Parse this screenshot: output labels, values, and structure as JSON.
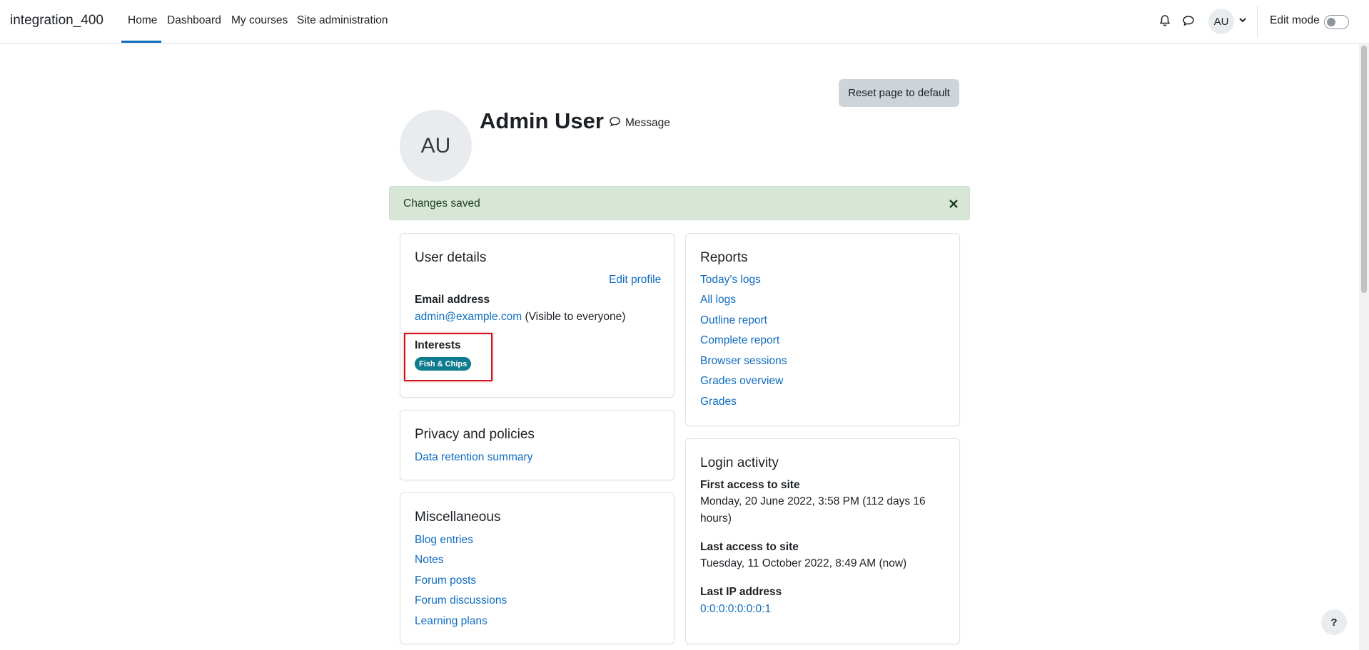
{
  "navbar": {
    "brand": "integration_400",
    "links": [
      "Home",
      "Dashboard",
      "My courses",
      "Site administration"
    ],
    "avatar_initials": "AU",
    "edit_mode_label": "Edit mode"
  },
  "header": {
    "reset_label": "Reset page to default",
    "avatar_initials": "AU",
    "user_name": "Admin User",
    "message_label": "Message"
  },
  "alert": {
    "text": "Changes saved"
  },
  "user_details": {
    "title": "User details",
    "edit_profile": "Edit profile",
    "email_label": "Email address",
    "email": "admin@example.com",
    "email_visibility": "(Visible to everyone)",
    "interests_label": "Interests",
    "interest_tag": "Fish & Chips"
  },
  "privacy": {
    "title": "Privacy and policies",
    "link": "Data retention summary"
  },
  "misc": {
    "title": "Miscellaneous",
    "links": [
      "Blog entries",
      "Notes",
      "Forum posts",
      "Forum discussions",
      "Learning plans"
    ]
  },
  "reports": {
    "title": "Reports",
    "links": [
      "Today's logs",
      "All logs",
      "Outline report",
      "Complete report",
      "Browser sessions",
      "Grades overview",
      "Grades"
    ]
  },
  "login_activity": {
    "title": "Login activity",
    "first_access_label": "First access to site",
    "first_access_line1": "Monday, 20 June 2022, 3:58 PM  (112 days 16",
    "first_access_line2": "hours)",
    "last_access_label": "Last access to site",
    "last_access_value": "Tuesday, 11 October 2022, 8:49 AM  (now)",
    "last_ip_label": "Last IP address",
    "last_ip_value": "0:0:0:0:0:0:0:1"
  },
  "help_label": "?",
  "colors": {
    "link": "#0f6cbf",
    "alert_bg": "#d7e6d7",
    "tag_bg": "#0f7b8f",
    "highlight": "#d0121b"
  }
}
